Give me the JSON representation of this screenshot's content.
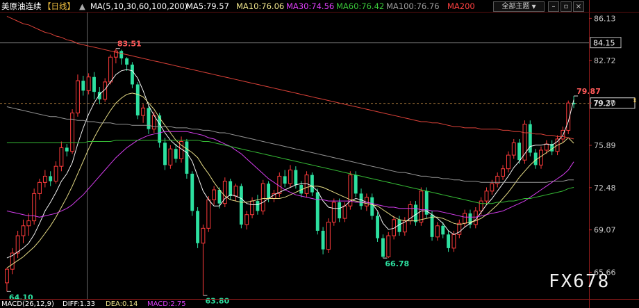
{
  "header": {
    "symbol_name": "美原油连续",
    "period": "【日线】",
    "ma_label": "MA(5,10,30,60,100,200)",
    "ma5": "MA5:79.57",
    "ma10": "MA10:76.06",
    "ma30": "MA30:74.56",
    "ma60": "MA60:76.42",
    "ma100": "MA100:76.76",
    "ma200": "MA200",
    "theme_select": "全部主题"
  },
  "footer": {
    "macd": "MACD(26,12,9)",
    "diff": "DIFF:1.33",
    "dea": "DEA:0.14",
    "macd_value": "MACD:2.75"
  },
  "watermark": "FX678",
  "price_tags": {
    "last_price": "79.27",
    "ref_price": "84.15"
  },
  "annotations": {
    "high": "83.51",
    "low_left": "64.10",
    "low_mid": "63.80",
    "low_right": "66.78",
    "recent_high": "79.87"
  },
  "colors": {
    "up": "#ff3b3b",
    "down": "#2de0a0",
    "ma5": "#ffffff",
    "ma10": "#f0e68c",
    "ma30": "#e040fb",
    "ma60": "#39c639",
    "ma100": "#9e9e9e",
    "ma200": "#e8463c"
  },
  "chart_data": {
    "type": "candlestick",
    "y_ticks": [
      "86.13",
      "82.72",
      "79.30",
      "75.89",
      "72.48",
      "69.07",
      "65.66"
    ],
    "ylim": [
      63.5,
      86.6
    ],
    "candles": [
      [
        64.8,
        65.9,
        64.1,
        66.0
      ],
      [
        65.9,
        67.2,
        65.5,
        67.6
      ],
      [
        67.2,
        68.6,
        66.8,
        69.0
      ],
      [
        68.6,
        69.4,
        68.0,
        69.9
      ],
      [
        69.4,
        69.8,
        68.6,
        70.4
      ],
      [
        69.8,
        72.0,
        69.5,
        72.4
      ],
      [
        72.0,
        72.9,
        71.5,
        73.2
      ],
      [
        72.9,
        73.4,
        72.5,
        73.9
      ],
      [
        73.4,
        73.0,
        72.6,
        73.8
      ],
      [
        73.0,
        74.2,
        72.8,
        74.6
      ],
      [
        74.2,
        75.7,
        73.8,
        76.2
      ],
      [
        75.7,
        75.4,
        75.0,
        76.0
      ],
      [
        75.4,
        78.5,
        75.2,
        78.8
      ],
      [
        78.5,
        81.1,
        78.2,
        81.6
      ],
      [
        81.1,
        80.3,
        79.9,
        81.5
      ],
      [
        80.3,
        81.4,
        80.0,
        81.7
      ],
      [
        81.4,
        80.2,
        79.6,
        81.8
      ],
      [
        80.2,
        79.6,
        79.2,
        80.6
      ],
      [
        79.6,
        81.0,
        79.4,
        81.3
      ],
      [
        81.0,
        83.0,
        80.8,
        83.2
      ],
      [
        83.0,
        83.5,
        82.5,
        83.7
      ],
      [
        83.5,
        82.9,
        82.4,
        83.6
      ],
      [
        82.9,
        82.4,
        81.9,
        83.0
      ],
      [
        82.4,
        80.8,
        80.5,
        82.6
      ],
      [
        80.8,
        78.3,
        78.0,
        81.0
      ],
      [
        78.3,
        78.9,
        77.7,
        79.2
      ],
      [
        78.9,
        77.2,
        76.8,
        79.1
      ],
      [
        77.2,
        78.3,
        76.9,
        78.6
      ],
      [
        78.3,
        76.1,
        75.7,
        78.5
      ],
      [
        76.1,
        74.3,
        73.9,
        76.5
      ],
      [
        74.3,
        75.6,
        74.0,
        75.9
      ],
      [
        75.6,
        74.8,
        74.5,
        76.0
      ],
      [
        74.8,
        76.2,
        74.5,
        76.6
      ],
      [
        76.2,
        73.6,
        73.2,
        76.4
      ],
      [
        73.6,
        70.6,
        70.2,
        73.8
      ],
      [
        70.6,
        68.0,
        67.6,
        70.9
      ],
      [
        68.0,
        69.2,
        63.8,
        69.5
      ],
      [
        69.2,
        71.5,
        68.9,
        71.8
      ],
      [
        71.5,
        72.3,
        71.1,
        72.6
      ],
      [
        72.3,
        71.2,
        70.8,
        72.5
      ],
      [
        71.2,
        73.0,
        70.9,
        73.3
      ],
      [
        73.0,
        71.8,
        71.5,
        73.2
      ],
      [
        71.8,
        72.6,
        71.4,
        72.8
      ],
      [
        72.6,
        69.5,
        69.2,
        72.8
      ],
      [
        69.5,
        70.3,
        69.1,
        70.6
      ],
      [
        70.3,
        71.4,
        70.0,
        71.7
      ],
      [
        71.4,
        70.6,
        70.3,
        71.9
      ],
      [
        70.6,
        72.8,
        70.3,
        73.1
      ],
      [
        72.8,
        71.6,
        71.3,
        73.0
      ],
      [
        71.6,
        72.0,
        71.3,
        72.3
      ],
      [
        72.0,
        73.4,
        71.7,
        73.7
      ],
      [
        73.4,
        72.8,
        72.5,
        73.9
      ],
      [
        72.8,
        73.9,
        72.5,
        74.3
      ],
      [
        73.9,
        72.7,
        72.4,
        74.2
      ],
      [
        72.7,
        72.0,
        71.7,
        73.0
      ],
      [
        72.0,
        73.5,
        71.7,
        73.8
      ],
      [
        73.5,
        72.1,
        71.8,
        73.7
      ],
      [
        72.1,
        69.0,
        68.7,
        72.4
      ],
      [
        69.0,
        67.5,
        67.1,
        69.3
      ],
      [
        67.5,
        69.7,
        67.2,
        70.0
      ],
      [
        69.7,
        71.3,
        69.4,
        71.6
      ],
      [
        71.3,
        70.0,
        69.7,
        71.6
      ],
      [
        70.0,
        71.0,
        69.7,
        71.3
      ],
      [
        71.0,
        73.5,
        70.7,
        73.8
      ],
      [
        73.5,
        72.0,
        71.7,
        73.8
      ],
      [
        72.0,
        71.0,
        70.7,
        72.4
      ],
      [
        71.0,
        71.7,
        70.6,
        72.0
      ],
      [
        71.7,
        70.2,
        69.9,
        72.0
      ],
      [
        70.2,
        68.4,
        68.1,
        70.5
      ],
      [
        68.4,
        66.9,
        66.8,
        68.7
      ],
      [
        66.9,
        68.6,
        66.8,
        68.9
      ],
      [
        68.6,
        69.9,
        68.3,
        70.2
      ],
      [
        69.9,
        68.9,
        68.6,
        70.2
      ],
      [
        68.9,
        69.8,
        68.6,
        70.1
      ],
      [
        69.8,
        71.1,
        69.5,
        71.4
      ],
      [
        71.1,
        69.7,
        69.4,
        71.4
      ],
      [
        69.7,
        72.2,
        69.4,
        72.5
      ],
      [
        72.2,
        70.3,
        70.0,
        72.5
      ],
      [
        70.3,
        68.5,
        68.2,
        70.6
      ],
      [
        68.5,
        69.4,
        68.2,
        69.7
      ],
      [
        69.4,
        68.7,
        68.4,
        69.7
      ],
      [
        68.7,
        67.6,
        67.3,
        69.0
      ],
      [
        67.6,
        68.7,
        67.3,
        69.0
      ],
      [
        68.7,
        69.6,
        68.4,
        69.9
      ],
      [
        69.6,
        70.4,
        69.3,
        70.7
      ],
      [
        70.4,
        69.5,
        69.2,
        70.7
      ],
      [
        69.5,
        70.6,
        69.2,
        70.9
      ],
      [
        70.6,
        71.4,
        70.3,
        71.7
      ],
      [
        71.4,
        72.2,
        71.1,
        72.5
      ],
      [
        72.2,
        72.8,
        71.9,
        73.1
      ],
      [
        72.8,
        73.4,
        72.5,
        73.7
      ],
      [
        73.4,
        74.0,
        73.1,
        74.3
      ],
      [
        74.0,
        75.1,
        73.7,
        75.4
      ],
      [
        75.1,
        76.1,
        74.8,
        76.4
      ],
      [
        76.1,
        74.7,
        74.4,
        76.4
      ],
      [
        74.7,
        77.6,
        74.4,
        77.9
      ],
      [
        77.6,
        75.3,
        75.0,
        77.9
      ],
      [
        75.3,
        74.3,
        74.0,
        75.6
      ],
      [
        74.3,
        75.5,
        74.0,
        75.8
      ],
      [
        75.5,
        76.0,
        75.2,
        76.3
      ],
      [
        76.0,
        75.4,
        75.1,
        76.3
      ],
      [
        75.4,
        76.4,
        75.1,
        76.7
      ],
      [
        76.4,
        77.1,
        76.1,
        77.4
      ],
      [
        77.1,
        79.3,
        76.8,
        79.5
      ],
      [
        79.3,
        79.2,
        78.9,
        79.87
      ]
    ],
    "series": [
      {
        "name": "MA5",
        "values": [
          66.8,
          67.0,
          67.3,
          67.6,
          68.0,
          68.7,
          69.6,
          70.6,
          71.3,
          72.1,
          73.0,
          73.6,
          74.5,
          76.0,
          77.3,
          78.4,
          79.3,
          80.0,
          80.4,
          81.0,
          81.6,
          81.9,
          82.0,
          81.9,
          81.3,
          80.3,
          79.1,
          78.3,
          77.6,
          76.9,
          76.3,
          75.9,
          75.6,
          75.3,
          74.6,
          73.4,
          72.2,
          71.5,
          71.0,
          71.0,
          71.6,
          71.9,
          71.8,
          71.6,
          71.2,
          71.1,
          71.1,
          71.3,
          71.6,
          71.9,
          72.1,
          72.3,
          72.5,
          72.7,
          72.8,
          72.8,
          72.6,
          72.2,
          71.4,
          70.9,
          70.8,
          70.8,
          71.0,
          71.4,
          71.6,
          71.5,
          71.3,
          71.2,
          70.6,
          69.6,
          69.1,
          69.2,
          69.5,
          69.7,
          70.0,
          70.3,
          70.6,
          70.6,
          70.3,
          70.0,
          69.6,
          69.0,
          68.7,
          68.9,
          69.3,
          69.6,
          69.9,
          70.5,
          71.1,
          71.6,
          72.2,
          72.8,
          73.4,
          74.1,
          74.6,
          75.2,
          75.8,
          75.9,
          75.9,
          76.0,
          75.9,
          76.2,
          76.7,
          77.8,
          79.57
        ]
      },
      {
        "name": "MA10",
        "values": [
          66.0,
          66.3,
          66.6,
          66.9,
          67.3,
          67.7,
          68.2,
          68.8,
          69.4,
          70.1,
          70.9,
          71.7,
          72.6,
          73.6,
          74.6,
          75.6,
          76.5,
          77.3,
          78.0,
          78.7,
          79.3,
          79.7,
          80.0,
          80.1,
          80.0,
          79.8,
          79.3,
          78.8,
          78.1,
          77.5,
          76.9,
          76.3,
          75.9,
          75.6,
          75.3,
          74.9,
          74.2,
          73.6,
          72.9,
          72.3,
          71.8,
          71.5,
          71.4,
          71.3,
          71.3,
          71.4,
          71.5,
          71.6,
          71.6,
          71.6,
          71.6,
          71.7,
          71.9,
          72.1,
          72.3,
          72.5,
          72.6,
          72.6,
          72.5,
          72.3,
          72.1,
          71.9,
          71.7,
          71.5,
          71.4,
          71.3,
          71.2,
          71.1,
          71.0,
          70.7,
          70.4,
          70.1,
          69.9,
          69.8,
          69.8,
          69.8,
          69.9,
          70.0,
          70.1,
          70.1,
          70.0,
          69.8,
          69.6,
          69.5,
          69.6,
          69.7,
          69.8,
          70.0,
          70.3,
          70.7,
          71.1,
          71.6,
          72.1,
          72.7,
          73.3,
          73.8,
          74.3,
          74.7,
          75.0,
          75.3,
          75.6,
          75.9,
          76.1,
          76.5,
          76.06
        ]
      },
      {
        "name": "MA30",
        "values": [
          70.6,
          70.5,
          70.4,
          70.3,
          70.2,
          70.2,
          70.1,
          70.2,
          70.3,
          70.4,
          70.6,
          70.8,
          71.1,
          71.5,
          71.9,
          72.4,
          72.9,
          73.4,
          73.9,
          74.4,
          74.9,
          75.3,
          75.7,
          76.0,
          76.3,
          76.5,
          76.7,
          76.8,
          76.9,
          77.0,
          77.0,
          77.0,
          77.0,
          77.0,
          76.9,
          76.8,
          76.7,
          76.5,
          76.4,
          76.2,
          76.0,
          75.8,
          75.5,
          75.2,
          74.8,
          74.4,
          74.0,
          73.6,
          73.2,
          72.9,
          72.6,
          72.3,
          72.1,
          71.9,
          71.8,
          71.7,
          71.6,
          71.5,
          71.5,
          71.4,
          71.4,
          71.4,
          71.4,
          71.4,
          71.3,
          71.3,
          71.3,
          71.2,
          71.1,
          71.0,
          70.9,
          70.9,
          70.8,
          70.8,
          70.8,
          70.8,
          70.7,
          70.7,
          70.6,
          70.6,
          70.5,
          70.4,
          70.3,
          70.2,
          70.1,
          70.1,
          70.1,
          70.2,
          70.3,
          70.4,
          70.5,
          70.6,
          70.8,
          71.0,
          71.2,
          71.4,
          71.7,
          72.0,
          72.3,
          72.6,
          72.9,
          73.2,
          73.5,
          73.9,
          74.56
        ]
      },
      {
        "name": "MA60",
        "values": [
          76.1,
          76.1,
          76.1,
          76.1,
          76.1,
          76.1,
          76.1,
          76.1,
          76.1,
          76.1,
          76.1,
          76.1,
          76.1,
          76.1,
          76.1,
          76.2,
          76.2,
          76.2,
          76.2,
          76.2,
          76.3,
          76.3,
          76.3,
          76.3,
          76.3,
          76.3,
          76.3,
          76.3,
          76.3,
          76.3,
          76.3,
          76.3,
          76.3,
          76.3,
          76.3,
          76.3,
          76.2,
          76.2,
          76.1,
          76.0,
          75.9,
          75.8,
          75.7,
          75.6,
          75.5,
          75.4,
          75.3,
          75.2,
          75.1,
          75.0,
          74.9,
          74.8,
          74.7,
          74.6,
          74.5,
          74.4,
          74.3,
          74.2,
          74.1,
          74.0,
          73.9,
          73.8,
          73.7,
          73.6,
          73.5,
          73.4,
          73.3,
          73.2,
          73.1,
          73.0,
          72.9,
          72.8,
          72.7,
          72.6,
          72.5,
          72.4,
          72.3,
          72.2,
          72.1,
          72.0,
          71.9,
          71.8,
          71.7,
          71.6,
          71.5,
          71.4,
          71.3,
          71.2,
          71.2,
          71.2,
          71.3,
          71.3,
          71.4,
          71.4,
          71.5,
          71.6,
          71.6,
          71.7,
          71.8,
          71.9,
          72.0,
          72.1,
          72.2,
          72.4,
          72.5
        ]
      },
      {
        "name": "MA100",
        "values": [
          79.0,
          78.9,
          78.8,
          78.7,
          78.6,
          78.5,
          78.4,
          78.3,
          78.2,
          78.2,
          78.1,
          78.0,
          78.0,
          77.9,
          77.9,
          77.8,
          77.8,
          77.7,
          77.7,
          77.7,
          77.6,
          77.6,
          77.6,
          77.5,
          77.5,
          77.5,
          77.5,
          77.4,
          77.4,
          77.4,
          77.4,
          77.3,
          77.3,
          77.3,
          77.2,
          77.2,
          77.1,
          77.1,
          77.0,
          76.9,
          76.9,
          76.8,
          76.7,
          76.6,
          76.5,
          76.4,
          76.3,
          76.2,
          76.1,
          76.0,
          75.9,
          75.8,
          75.7,
          75.6,
          75.5,
          75.4,
          75.3,
          75.2,
          75.1,
          75.0,
          74.9,
          74.8,
          74.7,
          74.6,
          74.5,
          74.4,
          74.3,
          74.2,
          74.1,
          74.0,
          73.9,
          73.8,
          73.7,
          73.7,
          73.6,
          73.5,
          73.4,
          73.4,
          73.3,
          73.3,
          73.2,
          73.2,
          73.1,
          73.1,
          73.0,
          73.0,
          73.0,
          72.9,
          72.9,
          72.9,
          72.9,
          72.9,
          72.9,
          72.9,
          72.9,
          72.9,
          72.9,
          72.9,
          72.9,
          72.9,
          73.0,
          73.0,
          73.0,
          73.1,
          73.1
        ]
      },
      {
        "name": "MA200",
        "values": [
          86.3,
          86.1,
          85.9,
          85.7,
          85.6,
          85.4,
          85.2,
          85.0,
          84.9,
          84.7,
          84.6,
          84.4,
          84.3,
          84.1,
          84.0,
          83.9,
          83.8,
          83.7,
          83.6,
          83.5,
          83.4,
          83.3,
          83.2,
          83.1,
          83.0,
          82.9,
          82.8,
          82.7,
          82.6,
          82.5,
          82.4,
          82.3,
          82.2,
          82.1,
          82.0,
          81.9,
          81.8,
          81.7,
          81.6,
          81.5,
          81.4,
          81.3,
          81.2,
          81.1,
          81.0,
          80.9,
          80.8,
          80.7,
          80.6,
          80.5,
          80.4,
          80.3,
          80.2,
          80.1,
          80.0,
          79.9,
          79.8,
          79.7,
          79.6,
          79.5,
          79.4,
          79.3,
          79.2,
          79.1,
          79.0,
          78.9,
          78.8,
          78.7,
          78.6,
          78.5,
          78.4,
          78.3,
          78.2,
          78.1,
          78.0,
          77.9,
          77.8,
          77.8,
          77.7,
          77.7,
          77.6,
          77.5,
          77.4,
          77.4,
          77.3,
          77.3,
          77.3,
          77.2,
          77.2,
          77.2,
          77.2,
          77.1,
          77.1,
          77.0,
          77.0,
          76.9,
          76.9,
          76.8,
          76.8,
          76.7,
          76.7,
          76.6,
          76.6,
          76.5,
          76.4
        ]
      }
    ]
  }
}
